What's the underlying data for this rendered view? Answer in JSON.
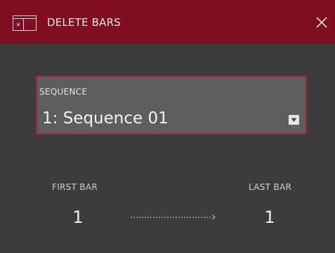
{
  "header": {
    "title": "DELETE BARS",
    "icon": "window-icon",
    "close_icon": "close-icon",
    "background_color": "#820e22"
  },
  "sequence": {
    "label": "SEQUENCE",
    "value": "1: Sequence 01",
    "dropdown_icon": "dropdown-arrow-icon",
    "border_color": "#b3202f"
  },
  "bars": {
    "first_label": "FIRST BAR",
    "first_value": "1",
    "arrow_icon": "dotted-arrow-icon",
    "last_label": "LAST BAR",
    "last_value": "1"
  }
}
